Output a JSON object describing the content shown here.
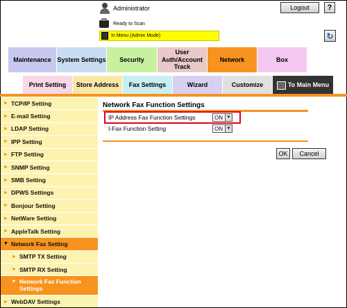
{
  "header": {
    "user": "Administrator",
    "logout_label": "Logout",
    "help_label": "?",
    "status": "Ready to Scan",
    "mode": "In Menu (Admin Mode)",
    "refresh_label": "↻"
  },
  "main_tabs": [
    {
      "label": "Maintenance",
      "color": "#c8c8f0"
    },
    {
      "label": "System Settings",
      "color": "#c8dcf4"
    },
    {
      "label": "Security",
      "color": "#c8f0a0"
    },
    {
      "label": "User Auth/Account Track",
      "color": "#e8c8c8"
    },
    {
      "label": "Network",
      "color": "#f7931e",
      "active": true
    },
    {
      "label": "Box",
      "color": "#f4c8f0"
    }
  ],
  "sub_tabs": [
    {
      "label": "Print Setting",
      "color": "#f8d8e8"
    },
    {
      "label": "Store Address",
      "color": "#f8e8a8"
    },
    {
      "label": "Fax Settings",
      "color": "#c8f0f4"
    },
    {
      "label": "Wizard",
      "color": "#d8d0f0"
    },
    {
      "label": "Customize",
      "color": "#e0e0e0"
    },
    {
      "label": "To Main Menu",
      "color": "#333333"
    }
  ],
  "sidebar": {
    "items": [
      {
        "label": "TCP/IP Setting"
      },
      {
        "label": "E-mail Setting"
      },
      {
        "label": "LDAP Setting"
      },
      {
        "label": "IPP Setting"
      },
      {
        "label": "FTP Setting"
      },
      {
        "label": "SNMP Setting"
      },
      {
        "label": "SMB Setting"
      },
      {
        "label": "DPWS Settings"
      },
      {
        "label": "Bonjour Setting"
      },
      {
        "label": "NetWare Setting"
      },
      {
        "label": "AppleTalk Setting"
      },
      {
        "label": "Network Fax Setting",
        "state": "active"
      },
      {
        "label": "SMTP TX Setting",
        "level": 2
      },
      {
        "label": "SMTP RX Setting",
        "level": 2
      },
      {
        "label": "Network Fax Function Settings",
        "level": 2,
        "state": "selected"
      },
      {
        "label": "WebDAV Settings"
      }
    ]
  },
  "content": {
    "title": "Network Fax Function Settings",
    "rows": [
      {
        "label": "IP Address Fax Function Settings",
        "value": "ON"
      },
      {
        "label": "I-Fax Function Setting",
        "value": "ON"
      }
    ],
    "ok_label": "OK",
    "cancel_label": "Cancel"
  },
  "colors": {
    "accent": "#f7931e",
    "sidebar_bg": "#fdf3b0",
    "mode_bar": "#ffff00",
    "highlight": "#e0001a"
  }
}
